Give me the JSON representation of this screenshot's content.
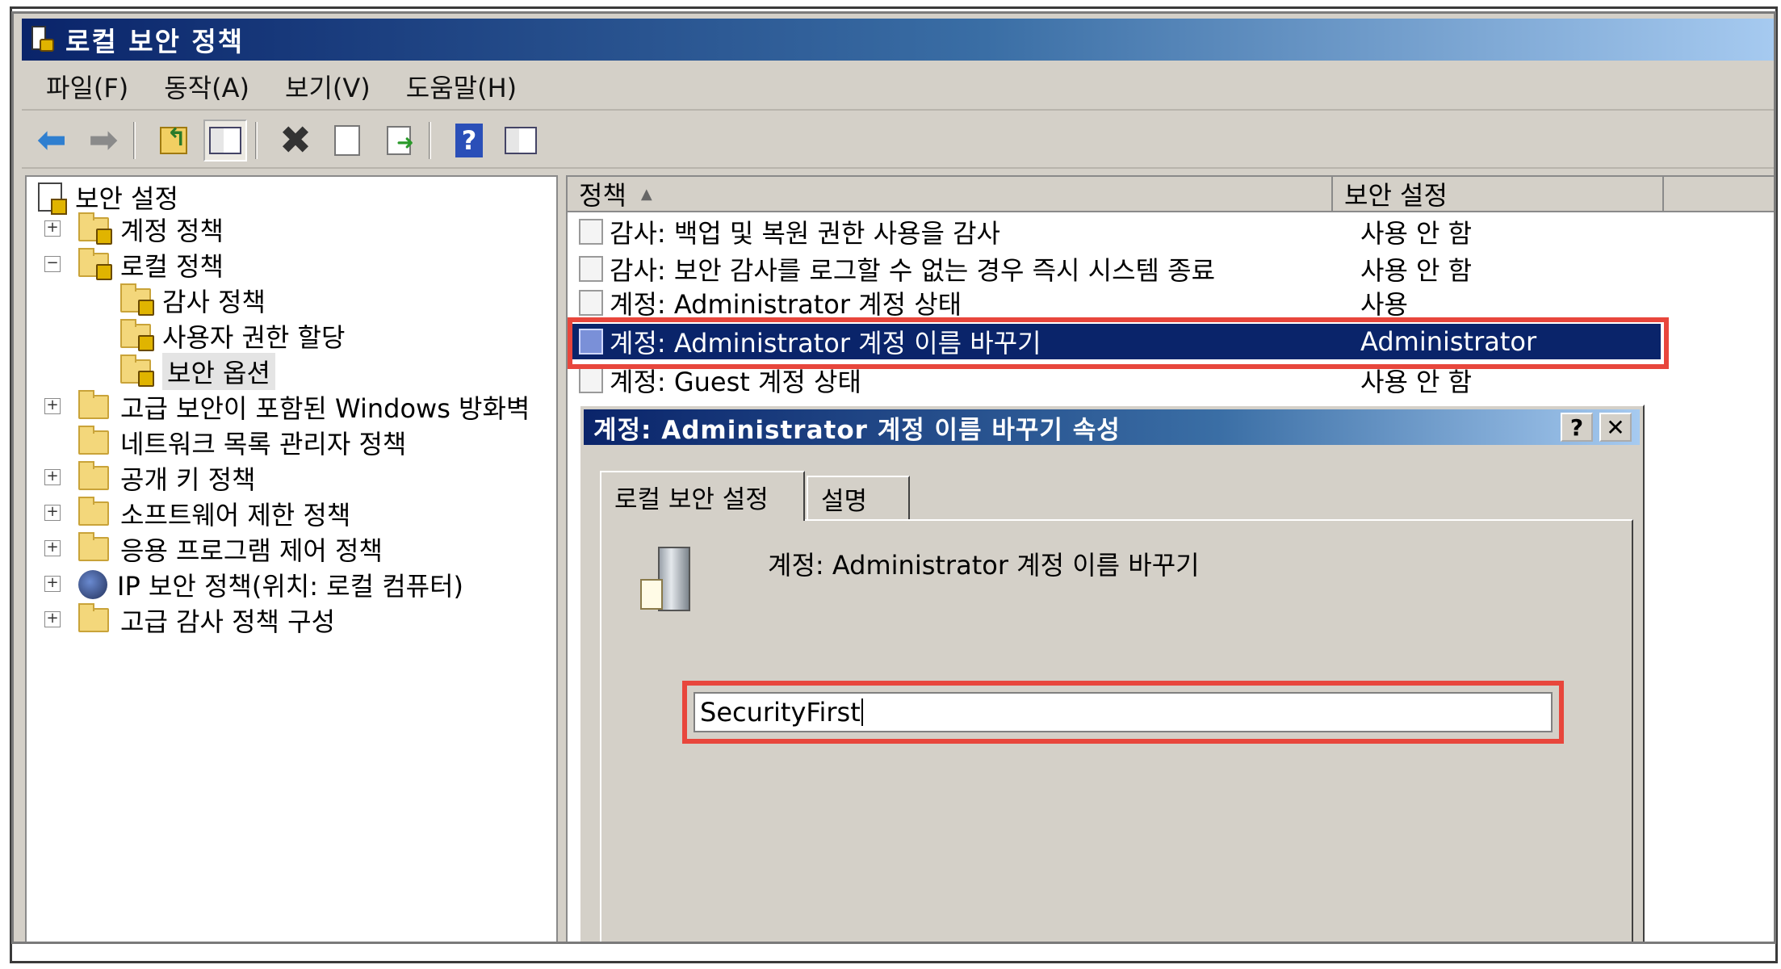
{
  "window": {
    "title": "로컬 보안 정책"
  },
  "menu": [
    "파일(F)",
    "동작(A)",
    "보기(V)",
    "도움말(H)"
  ],
  "toolbar": {
    "icons": [
      "back-icon",
      "forward-icon",
      "up-folder-icon",
      "show-hide-tree-icon",
      "delete-icon",
      "properties-icon",
      "export-list-icon",
      "help-icon",
      "console-tree-icon"
    ]
  },
  "tree": {
    "root": "보안 설정",
    "items": [
      {
        "label": "계정 정책",
        "expander": "+"
      },
      {
        "label": "로컬 정책",
        "expander": "−"
      },
      {
        "label": "감사 정책"
      },
      {
        "label": "사용자 권한 할당"
      },
      {
        "label": "보안 옵션"
      },
      {
        "label": "고급 보안이 포함된 Windows 방화벽",
        "expander": "+"
      },
      {
        "label": "네트워크 목록 관리자 정책"
      },
      {
        "label": "공개 키 정책",
        "expander": "+"
      },
      {
        "label": "소프트웨어 제한 정책",
        "expander": "+"
      },
      {
        "label": "응용 프로그램 제어 정책",
        "expander": "+"
      },
      {
        "label": "IP 보안 정책(위치: 로컬 컴퓨터)",
        "expander": "+"
      },
      {
        "label": "고급 감사 정책 구성",
        "expander": "+"
      }
    ]
  },
  "list": {
    "columns": [
      "정책",
      "보안 설정"
    ],
    "rows": [
      {
        "policy": "감사: 백업 및 복원 권한 사용을 감사",
        "setting": "사용 안 함"
      },
      {
        "policy": "감사: 보안 감사를 로그할 수 없는 경우 즉시 시스템 종료",
        "setting": "사용 안 함"
      },
      {
        "policy": "계정: Administrator 계정 상태",
        "setting": "사용"
      },
      {
        "policy": "계정: Administrator 계정 이름 바꾸기",
        "setting": "Administrator"
      },
      {
        "policy": "계정: Guest 계정 상태",
        "setting": "사용 안 함"
      }
    ]
  },
  "dialog": {
    "title": "계정: Administrator 계정 이름 바꾸기 속성",
    "help_button": "?",
    "close_button": "✕",
    "tabs": [
      "로컬 보안 설정",
      "설명"
    ],
    "heading": "계정: Administrator 계정 이름 바꾸기",
    "input_value": "SecurityFirst"
  },
  "colors": {
    "selection": "#0a246a",
    "highlight_box": "#e8463c",
    "face": "#d4d0c8"
  }
}
